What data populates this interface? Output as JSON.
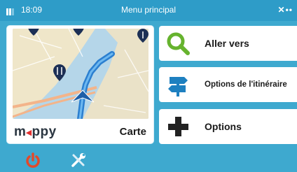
{
  "status": {
    "time": "18:09",
    "title": "Menu principal",
    "battery_icon": "battery-icon",
    "gps_icon": "gps-signal-icon"
  },
  "map_card": {
    "brand_prefix": "m",
    "brand_arrow": "◂",
    "brand_suffix": "ppy",
    "label": "Carte"
  },
  "menu": {
    "items": [
      {
        "label": "Aller vers",
        "icon": "magnifier-icon"
      },
      {
        "label": "Options de l'itinéraire",
        "icon": "signpost-icon"
      },
      {
        "label": "Options",
        "icon": "plus-icon"
      }
    ]
  },
  "bottom": {
    "power_icon": "power-icon",
    "tools_icon": "tools-icon"
  },
  "colors": {
    "background": "#3ea9cf",
    "status_bar": "#2e9cc8",
    "accent_green": "#66b32e",
    "accent_blue": "#1e80c0",
    "power_red": "#e3492a"
  }
}
